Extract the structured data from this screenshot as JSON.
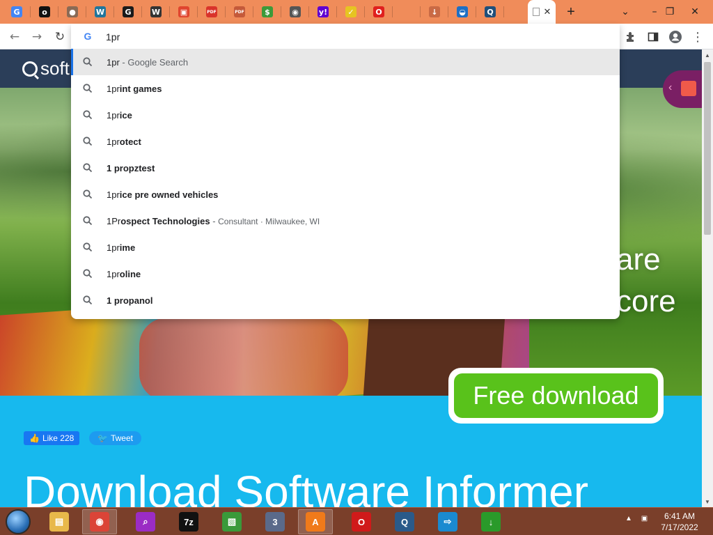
{
  "tabs": [
    {
      "name": "google",
      "glyph": "G",
      "color": "#4285f4"
    },
    {
      "name": "app-o",
      "glyph": "o",
      "color": "#111111"
    },
    {
      "name": "globe",
      "glyph": "●",
      "color": "#8a6a55"
    },
    {
      "name": "wordpress",
      "glyph": "W",
      "color": "#21759b"
    },
    {
      "name": "grammarly",
      "glyph": "G",
      "color": "#1a1a1a"
    },
    {
      "name": "wikipedia",
      "glyph": "W",
      "color": "#333333"
    },
    {
      "name": "gift",
      "glyph": "▣",
      "color": "#e0452e"
    },
    {
      "name": "pdf",
      "glyph": "PDF",
      "color": "#d9342b"
    },
    {
      "name": "pdf-2",
      "glyph": "PDF",
      "color": "#c45a3a"
    },
    {
      "name": "money",
      "glyph": "$",
      "color": "#3d9a3a"
    },
    {
      "name": "chrome",
      "glyph": "◉",
      "color": "#555555"
    },
    {
      "name": "yahoo",
      "glyph": "y!",
      "color": "#5f01d1"
    },
    {
      "name": "check",
      "glyph": "✓",
      "color": "#e6c422"
    },
    {
      "name": "opera",
      "glyph": "O",
      "color": "#e0201e"
    },
    {
      "name": "blank",
      "glyph": "",
      "color": "#f08c5a"
    },
    {
      "name": "download",
      "glyph": "↓",
      "color": "#c96a45"
    },
    {
      "name": "cloud",
      "glyph": "◒",
      "color": "#1e6fc4"
    },
    {
      "name": "qfind",
      "glyph": "Q",
      "color": "#1f4f7a"
    }
  ],
  "colors": {
    "tabstrip": "#f08c5a",
    "header": "#2b3e59",
    "page_blue": "#17b9ee",
    "download_green": "#59c21b",
    "selection_blue": "#1a73e8",
    "taskbar": "#7a3f2a"
  },
  "toolbar": {
    "back_icon": "←",
    "forward_icon": "→",
    "reload_icon": "↻",
    "extensions_icon": "puzzle-icon",
    "sidepanel_icon": "side-panel-icon",
    "profile_icon": "profile-icon",
    "menu_icon": "⋮"
  },
  "omnibox": {
    "value": "1pr",
    "suggestions": [
      {
        "typed": "1pr",
        "rest": "",
        "suffix": " - Google Search",
        "detail": ""
      },
      {
        "typed": "1pr",
        "rest": "int games",
        "suffix": "",
        "detail": ""
      },
      {
        "typed": "1pr",
        "rest": "ice",
        "suffix": "",
        "detail": ""
      },
      {
        "typed": "1pr",
        "rest": "otect",
        "suffix": "",
        "detail": ""
      },
      {
        "typed": "",
        "rest": "1 propztest",
        "suffix": "",
        "detail": ""
      },
      {
        "typed": "1pr",
        "rest": "ice pre owned vehicles",
        "suffix": "",
        "detail": ""
      },
      {
        "typed": "1Pr",
        "rest": "ospect Technologies",
        "suffix": " - ",
        "detail": "Consultant · Milwaukee, WI"
      },
      {
        "typed": "1pr",
        "rest": "ime",
        "suffix": "",
        "detail": ""
      },
      {
        "typed": "1pr",
        "rest": "oline",
        "suffix": "",
        "detail": ""
      },
      {
        "typed": "",
        "rest": "1 propanol",
        "suffix": "",
        "detail": ""
      }
    ]
  },
  "page": {
    "logo_text": "soft",
    "hero_line1": "are",
    "hero_line2": "core",
    "download_label": "Free download",
    "like_label": "Like 228",
    "tweet_label": "Tweet",
    "big_title": "Download Software Informer"
  },
  "taskbar": {
    "apps": [
      {
        "name": "file-explorer",
        "glyph": "▤",
        "color": "#e8b84a",
        "pinned": false
      },
      {
        "name": "chrome",
        "glyph": "◉",
        "color": "#db4437",
        "pinned": true
      },
      {
        "name": "search-app",
        "glyph": "⌕",
        "color": "#9b2cc4",
        "pinned": false
      },
      {
        "name": "7zip",
        "glyph": "7z",
        "color": "#111111",
        "pinned": false
      },
      {
        "name": "photos",
        "glyph": "▧",
        "color": "#3a9a3a",
        "pinned": false
      },
      {
        "name": "database",
        "glyph": "3",
        "color": "#5a6a8a",
        "pinned": false
      },
      {
        "name": "avast",
        "glyph": "A",
        "color": "#f07a1a",
        "pinned": true
      },
      {
        "name": "opera",
        "glyph": "O",
        "color": "#d01a1a",
        "pinned": false
      },
      {
        "name": "qfind",
        "glyph": "Q",
        "color": "#2a5a8a",
        "pinned": false
      },
      {
        "name": "remote",
        "glyph": "⇨",
        "color": "#1a8ad0",
        "pinned": false
      },
      {
        "name": "downloader",
        "glyph": "↓",
        "color": "#2a9a2a",
        "pinned": false
      }
    ],
    "time": "6:41 AM",
    "date": "7/17/2022"
  }
}
